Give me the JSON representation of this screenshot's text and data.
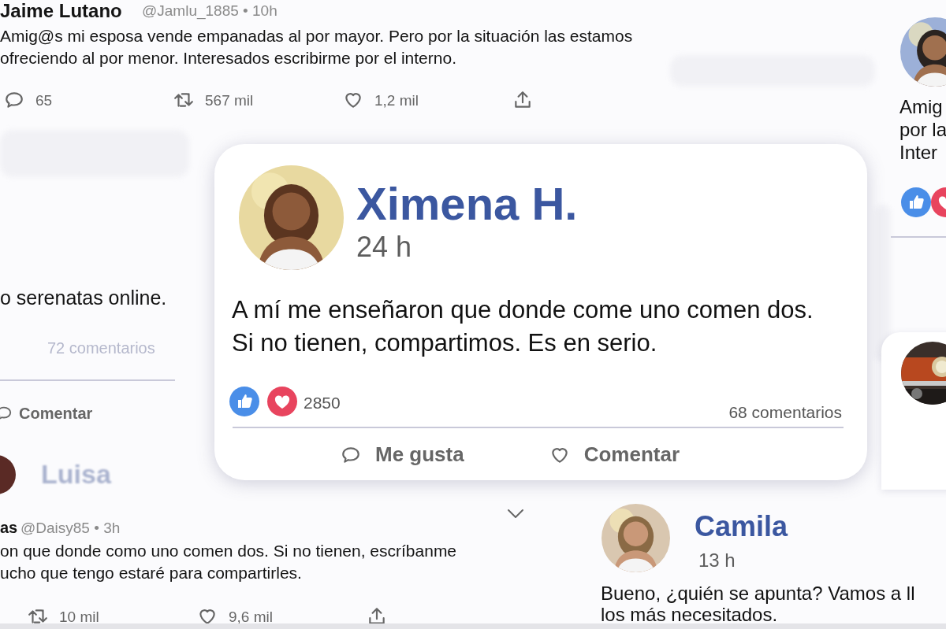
{
  "tweet_top": {
    "author": "Jaime Lutano",
    "meta": "@Jamlu_1885 • 10h",
    "text": "Amig@s mi esposa vende empanadas al por mayor. Pero por la situación las estamos\nofreciendo al por menor. Interesados escribirme por el interno.",
    "stats": [
      {
        "kind": "reply",
        "count": "65"
      },
      {
        "kind": "retweet",
        "count": "567 mil"
      },
      {
        "kind": "like",
        "count": "1,2 mil"
      },
      {
        "kind": "share"
      }
    ]
  },
  "post_left": {
    "text": "o serenatas online.",
    "comments": "72 comentarios",
    "action": {
      "kind": "comment",
      "label": "Comentar"
    }
  },
  "main_post": {
    "author": "Ximena H.",
    "time": "24 h",
    "text": "A mí me enseñaron que donde come uno comen dos.\nSi no tienen, compartimos. Es en serio.",
    "reaction_count": "2850",
    "comments": "68 comentarios",
    "actions": [
      {
        "kind": "comment",
        "label": "Me gusta"
      },
      {
        "kind": "like",
        "label": "Comentar"
      }
    ]
  },
  "post_luisa": {
    "author": "Luisa"
  },
  "tweet_bottom": {
    "author": "as",
    "meta": "@Daisy85 • 3h",
    "text": "on que donde como uno comen dos. Si no tienen, escríbanme\nucho que tengo estaré para compartirles.",
    "stats": [
      {
        "kind": "retweet",
        "count": "10 mil"
      },
      {
        "kind": "like",
        "count": "9,6 mil"
      },
      {
        "kind": "share"
      }
    ]
  },
  "post_camila": {
    "author": "Camila",
    "time": "13 h",
    "text": "Bueno, ¿quién se apunta? Vamos a ll\nlos más necesitados."
  },
  "post_right": {
    "text": "Amig\npor la\nInter"
  }
}
